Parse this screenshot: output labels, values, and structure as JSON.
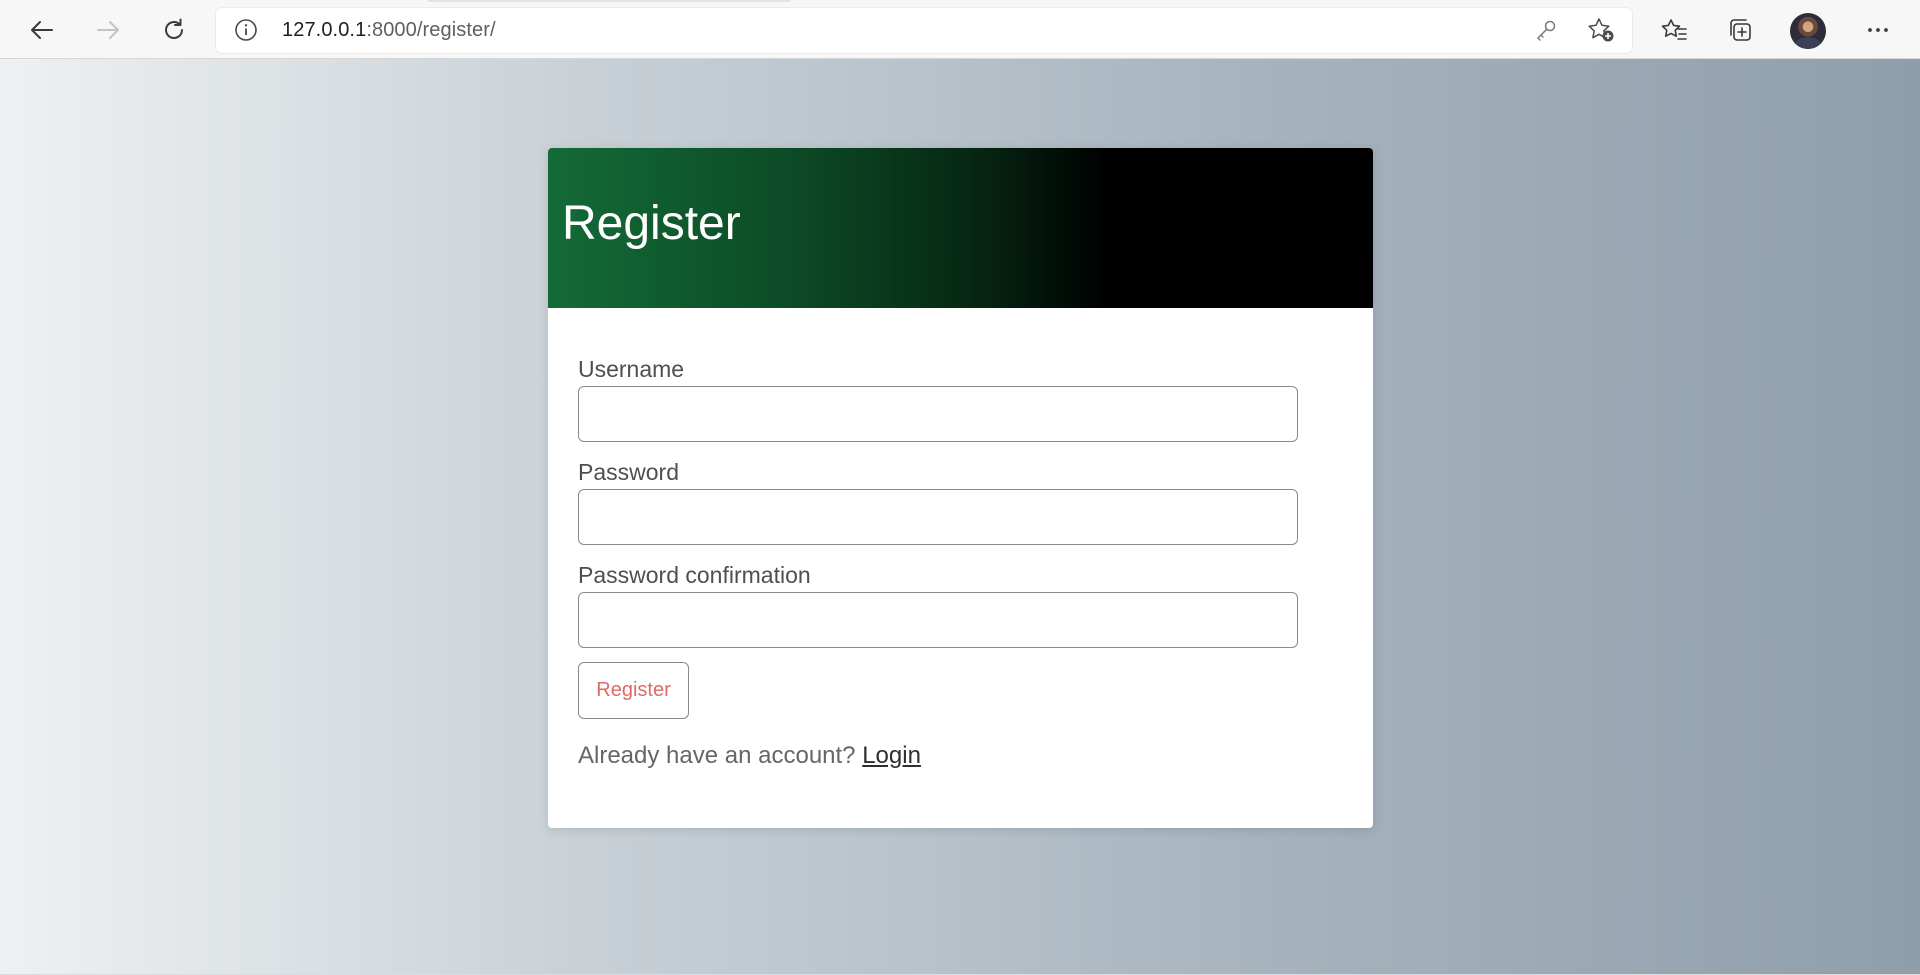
{
  "browser": {
    "url_host": "127.0.0.1",
    "url_path": ":8000/register/",
    "icons": [
      "back-arrow-icon",
      "forward-arrow-icon",
      "refresh-icon",
      "info-icon",
      "key-icon",
      "add-favorite-icon",
      "favorites-icon",
      "collections-icon",
      "profile-avatar",
      "more-options-icon"
    ]
  },
  "register_form": {
    "title": "Register",
    "username_label": "Username",
    "username_value": "",
    "password_label": "Password",
    "password_value": "",
    "password_confirmation_label": "Password confirmation",
    "password_confirmation_value": "",
    "submit_label": "Register",
    "account_prompt": "Already have an account?",
    "login_link": "Login"
  },
  "colors": {
    "header_gradient_start": "#146b37",
    "header_gradient_end": "#000000",
    "button_text": "#e06b63",
    "background_left": "#eef1f2",
    "background_right": "#8e9eab"
  }
}
